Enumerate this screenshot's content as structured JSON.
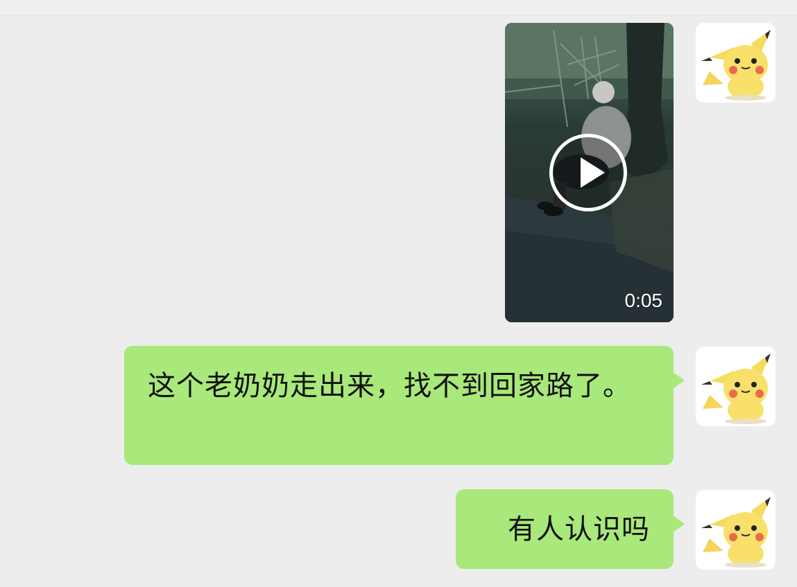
{
  "conversation": {
    "messages": [
      {
        "type": "video",
        "duration": "0:05",
        "icon": "play-icon"
      },
      {
        "type": "text",
        "text": "这个老奶奶走出来，找不到回家路了。"
      },
      {
        "type": "text",
        "text": "有人认识吗"
      }
    ]
  },
  "theme": {
    "background": "#ededed",
    "sent_bubble": "#a9e87a",
    "text": "#111111"
  }
}
